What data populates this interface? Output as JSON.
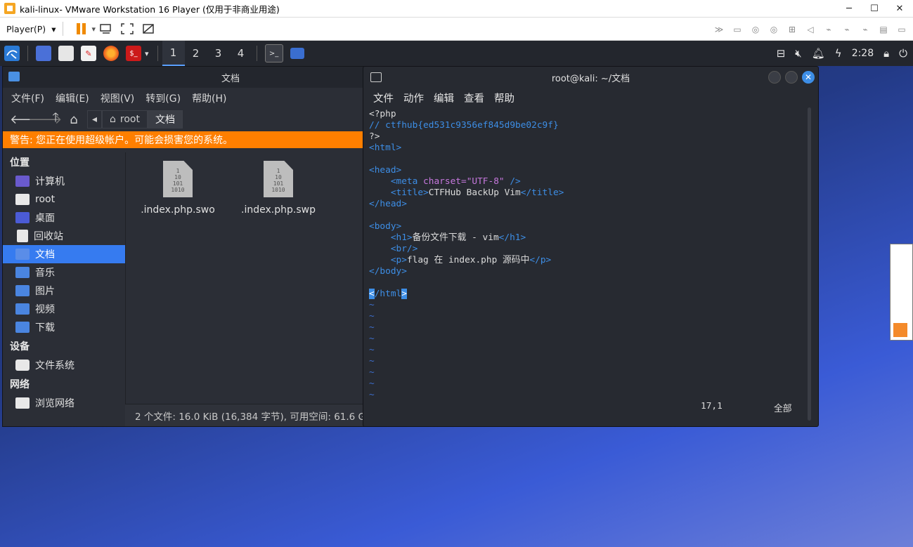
{
  "vmware": {
    "title": "kali-linux- VMware Workstation 16 Player (仅用于非商业用途)",
    "player_menu": "Player(P)"
  },
  "panel": {
    "workspaces": [
      "1",
      "2",
      "3",
      "4"
    ],
    "active_workspace": "1",
    "clock": "2:28"
  },
  "file_manager": {
    "title": "文档",
    "menu": [
      "文件(F)",
      "编辑(E)",
      "视图(V)",
      "转到(G)",
      "帮助(H)"
    ],
    "breadcrumbs": [
      "root",
      "文档"
    ],
    "warning": "警告: 您正在使用超级帐户。可能会损害您的系统。",
    "sections": {
      "places": "位置",
      "devices": "设备",
      "network": "网络"
    },
    "places": [
      "计算机",
      "root",
      "桌面",
      "回收站",
      "文档",
      "音乐",
      "图片",
      "视频",
      "下载"
    ],
    "devices": [
      "文件系统"
    ],
    "network": [
      "浏览网络"
    ],
    "files": [
      {
        "name": ".index.php.swo",
        "icon_text": "1\n10\n101\n1010"
      },
      {
        "name": ".index.php.swp",
        "icon_text": "1\n10\n101\n1010"
      }
    ],
    "status": "2 个文件: 16.0 KiB (16,384 字节), 可用空间: 61.6 GiB"
  },
  "terminal": {
    "title": "root@kali: ~/文档",
    "menu": [
      "文件",
      "动作",
      "编辑",
      "查看",
      "帮助"
    ],
    "lines": {
      "l1": "<?php",
      "l2": "// ctfhub{ed531c9356ef845d9be02c9f}",
      "l3": "?>",
      "l4": "<html>",
      "l6": "<head>",
      "l7a": "    <meta ",
      "l7b": "charset=",
      "l7c": "\"UTF-8\"",
      "l7d": " />",
      "l8a": "    <title>",
      "l8b": "CTFHub BackUp Vim",
      "l8c": "</title>",
      "l9": "</head>",
      "l11": "<body>",
      "l12a": "    <h1>",
      "l12b": "备份文件下载 - vim",
      "l12c": "</h1>",
      "l13": "    <br/>",
      "l14a": "    <p>",
      "l14b": "flag 在 index.php 源码中",
      "l14c": "</p>",
      "l15": "</body>",
      "l17a": "<",
      "l17b": "/html",
      "l17c": ">",
      "tilde": "~"
    },
    "position": "17,1",
    "scroll": "全部"
  }
}
